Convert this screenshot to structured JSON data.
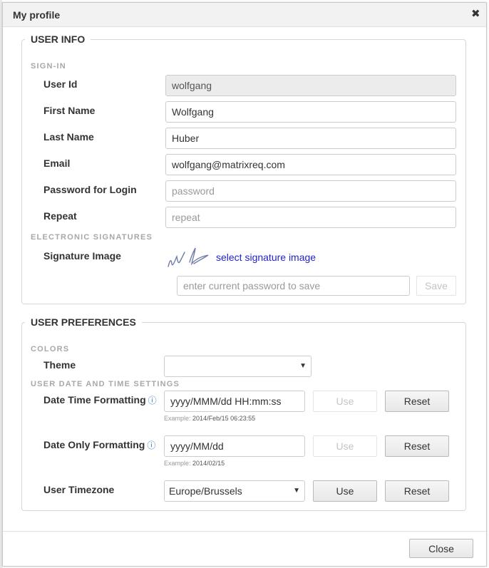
{
  "dialog": {
    "title": "My profile",
    "close_icon": "close-icon"
  },
  "user_info": {
    "legend": "USER INFO",
    "signin_heading": "SIGN-IN",
    "fields": [
      {
        "label": "User Id",
        "value": "wolfgang",
        "placeholder": "",
        "readonly": true
      },
      {
        "label": "First Name",
        "value": "Wolfgang",
        "placeholder": ""
      },
      {
        "label": "Last Name",
        "value": "Huber",
        "placeholder": ""
      },
      {
        "label": "Email",
        "value": "wolfgang@matrixreq.com",
        "placeholder": ""
      },
      {
        "label": "Password for Login",
        "value": "",
        "placeholder": "password"
      },
      {
        "label": "Repeat",
        "value": "",
        "placeholder": "repeat"
      }
    ],
    "esig_heading": "ELECTRONIC SIGNATURES",
    "signature_label": "Signature Image",
    "signature_icon": "signature-scribble-image",
    "select_signature_link": "select signature image",
    "current_password_placeholder": "enter current password to save",
    "save_label": "Save"
  },
  "user_prefs": {
    "legend": "USER PREFERENCES",
    "colors_heading": "COLORS",
    "theme_label": "Theme",
    "theme_value": "",
    "datetime_heading": "USER DATE AND TIME SETTINGS",
    "date_time_label": "Date Time Formatting",
    "date_time_value": "yyyy/MMM/dd HH:mm:ss",
    "date_time_example_prefix": "Example:",
    "date_time_example": "2014/Feb/15 06:23:55",
    "date_only_label": "Date Only Formatting",
    "date_only_value": "yyyy/MM/dd",
    "date_only_example_prefix": "Example:",
    "date_only_example": "2014/02/15",
    "timezone_label": "User Timezone",
    "timezone_value": "Europe/Brussels",
    "use_label": "Use",
    "reset_label": "Reset",
    "info_icon": "info-icon"
  },
  "footer": {
    "close_label": "Close"
  },
  "colors": {
    "link": "#2222cc",
    "section_heading": "#a8a8a8",
    "titlebar_bg": "#f2f2f2",
    "readonly_bg": "#ececec"
  }
}
